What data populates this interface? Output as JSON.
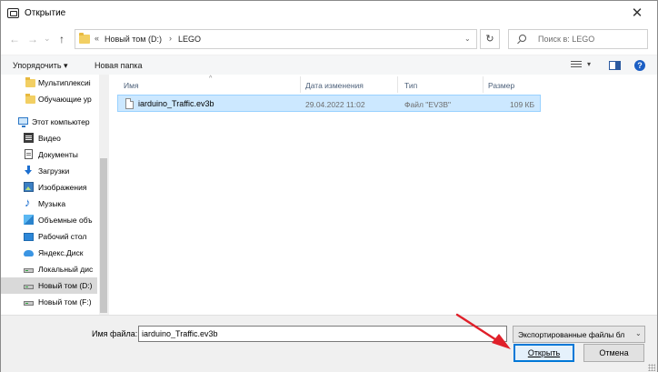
{
  "window": {
    "title": "Открытие",
    "close_glyph": "✕"
  },
  "nav": {
    "back": "←",
    "forward": "→",
    "dropdown": "⌄",
    "up": "↑",
    "breadcrumb": {
      "overflow": "«",
      "drive": "Новый том (D:)",
      "sep": "›",
      "folder": "LEGO"
    },
    "address_drop": "⌄",
    "refresh": "↻",
    "search_placeholder": "Поиск в: LEGO"
  },
  "toolbar": {
    "organize": "Упорядочить ▾",
    "new_folder": "Новая папка",
    "view_drop": "▾",
    "help": "?"
  },
  "sidebar": {
    "items": [
      {
        "label": "Мультиплексиі",
        "icon": "folder-icon"
      },
      {
        "label": "Обучающие ур",
        "icon": "folder-icon"
      },
      {
        "label": "Этот компьютер",
        "icon": "computer-icon"
      },
      {
        "label": "Видео",
        "icon": "video-icon"
      },
      {
        "label": "Документы",
        "icon": "documents-icon"
      },
      {
        "label": "Загрузки",
        "icon": "downloads-icon"
      },
      {
        "label": "Изображения",
        "icon": "images-icon"
      },
      {
        "label": "Музыка",
        "icon": "music-icon"
      },
      {
        "label": "Объемные объ",
        "icon": "3d-objects-icon"
      },
      {
        "label": "Рабочий стол",
        "icon": "desktop-icon"
      },
      {
        "label": "Яндекс.Диск",
        "icon": "yandex-disk-icon"
      },
      {
        "label": "Локальный дис",
        "icon": "drive-icon"
      },
      {
        "label": "Новый том (D:)",
        "icon": "drive-icon"
      },
      {
        "label": "Новый том (F:)",
        "icon": "drive-icon"
      }
    ]
  },
  "filelist": {
    "sort_indicator": "^",
    "columns": {
      "name": "Имя",
      "date": "Дата изменения",
      "type": "Тип",
      "size": "Размер"
    },
    "rows": [
      {
        "name": "iarduino_Traffic.ev3b",
        "date": "29.04.2022 11:02",
        "type": "Файл \"EV3B\"",
        "size": "109 КБ"
      }
    ]
  },
  "footer": {
    "filename_label": "Имя файла:",
    "filename_value": "iarduino_Traffic.ev3b",
    "filetype_value": "Экспортированные файлы бл",
    "filetype_chevron": "⌄",
    "open_label": "Открыть",
    "cancel_label": "Отмена"
  },
  "colors": {
    "selection": "#cce8ff",
    "accent": "#0078d7",
    "annotation": "#e0202a"
  }
}
